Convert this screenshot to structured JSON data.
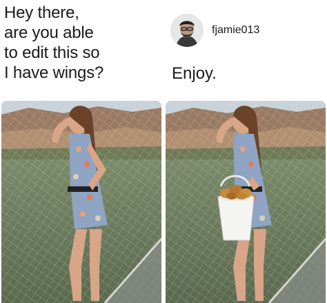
{
  "request": {
    "lines": [
      "Hey there,",
      "are you able",
      "to edit this so",
      "I have wings?"
    ]
  },
  "reply": {
    "username": "fjamie013",
    "message": "Enjoy."
  },
  "photos": {
    "original": {
      "subject": "woman-on-bridge-photo"
    },
    "edited": {
      "subject": "woman-holding-bucket-of-chicken-wings-photo"
    }
  }
}
